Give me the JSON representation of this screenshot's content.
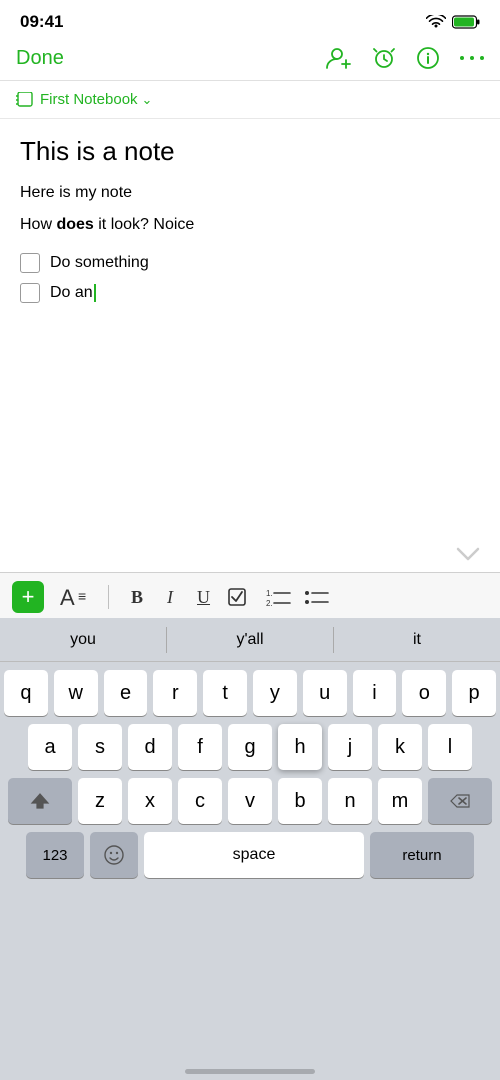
{
  "statusBar": {
    "time": "09:41"
  },
  "navBar": {
    "doneLabel": "Done",
    "icons": [
      "add-person",
      "alarm",
      "info",
      "more"
    ]
  },
  "notebook": {
    "name": "First Notebook"
  },
  "note": {
    "title": "This is a note",
    "bodyLine1": "Here is my note",
    "bodyLine2Normal": "How ",
    "bodyLine2Bold": "does",
    "bodyLine2Rest": " it look? Noice",
    "checkItem1": "Do something",
    "checkItem2": "Do an"
  },
  "autocomplete": {
    "items": [
      "you",
      "y'all",
      "it"
    ]
  },
  "keyboard": {
    "rows": [
      [
        "q",
        "w",
        "e",
        "r",
        "t",
        "y",
        "u",
        "i",
        "o",
        "p"
      ],
      [
        "a",
        "s",
        "d",
        "f",
        "g",
        "h",
        "j",
        "k",
        "l"
      ],
      [
        "z",
        "x",
        "c",
        "v",
        "b",
        "n",
        "m"
      ]
    ],
    "spaceLabel": "space",
    "returnLabel": "return",
    "numsLabel": "123"
  },
  "formatToolbar": {
    "plusLabel": "+",
    "boldLabel": "B",
    "italicLabel": "I",
    "underlineLabel": "U"
  }
}
